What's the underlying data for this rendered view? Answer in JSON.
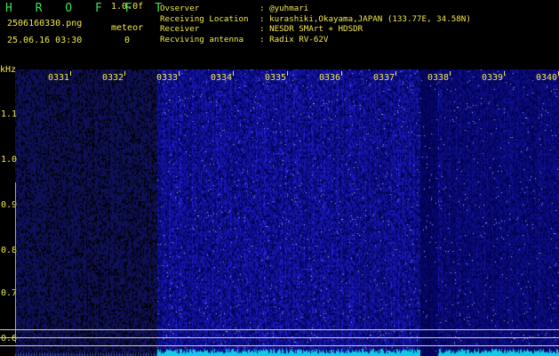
{
  "header": {
    "app_title": "H R O F F T",
    "version": "1.0.0f",
    "filename": "2506160330.png",
    "meteor_label": "meteor",
    "timestamp": "25.06.16 03:30",
    "meteor_count": "0"
  },
  "info": [
    {
      "key": "Ovserver",
      "value": ": @yuhmari"
    },
    {
      "key": "Receiving Location",
      "value": ": kurashiki,Okayama,JAPAN (133.77E, 34.58N)"
    },
    {
      "key": "Receiver",
      "value": ": NESDR SMArt + HDSDR"
    },
    {
      "key": "Recviving antenna",
      "value": ": Radix RV-62V"
    }
  ],
  "spectrogram": {
    "y_unit": "kHz",
    "y_ticks": [
      "1.1",
      "1.0",
      "0.9",
      "0.8",
      "0.7",
      "0.6"
    ],
    "x_ticks": [
      "0331",
      "0332",
      "0333",
      "0334",
      "0335",
      "0336",
      "0337",
      "0338",
      "0339",
      "0340"
    ],
    "colors": {
      "background": "#000000",
      "noise_blue": "#1a22c8",
      "baseline_cyan": "#12c9e6",
      "title_green": "#3ee05a",
      "tick_yellow": "#f2e94a"
    }
  }
}
